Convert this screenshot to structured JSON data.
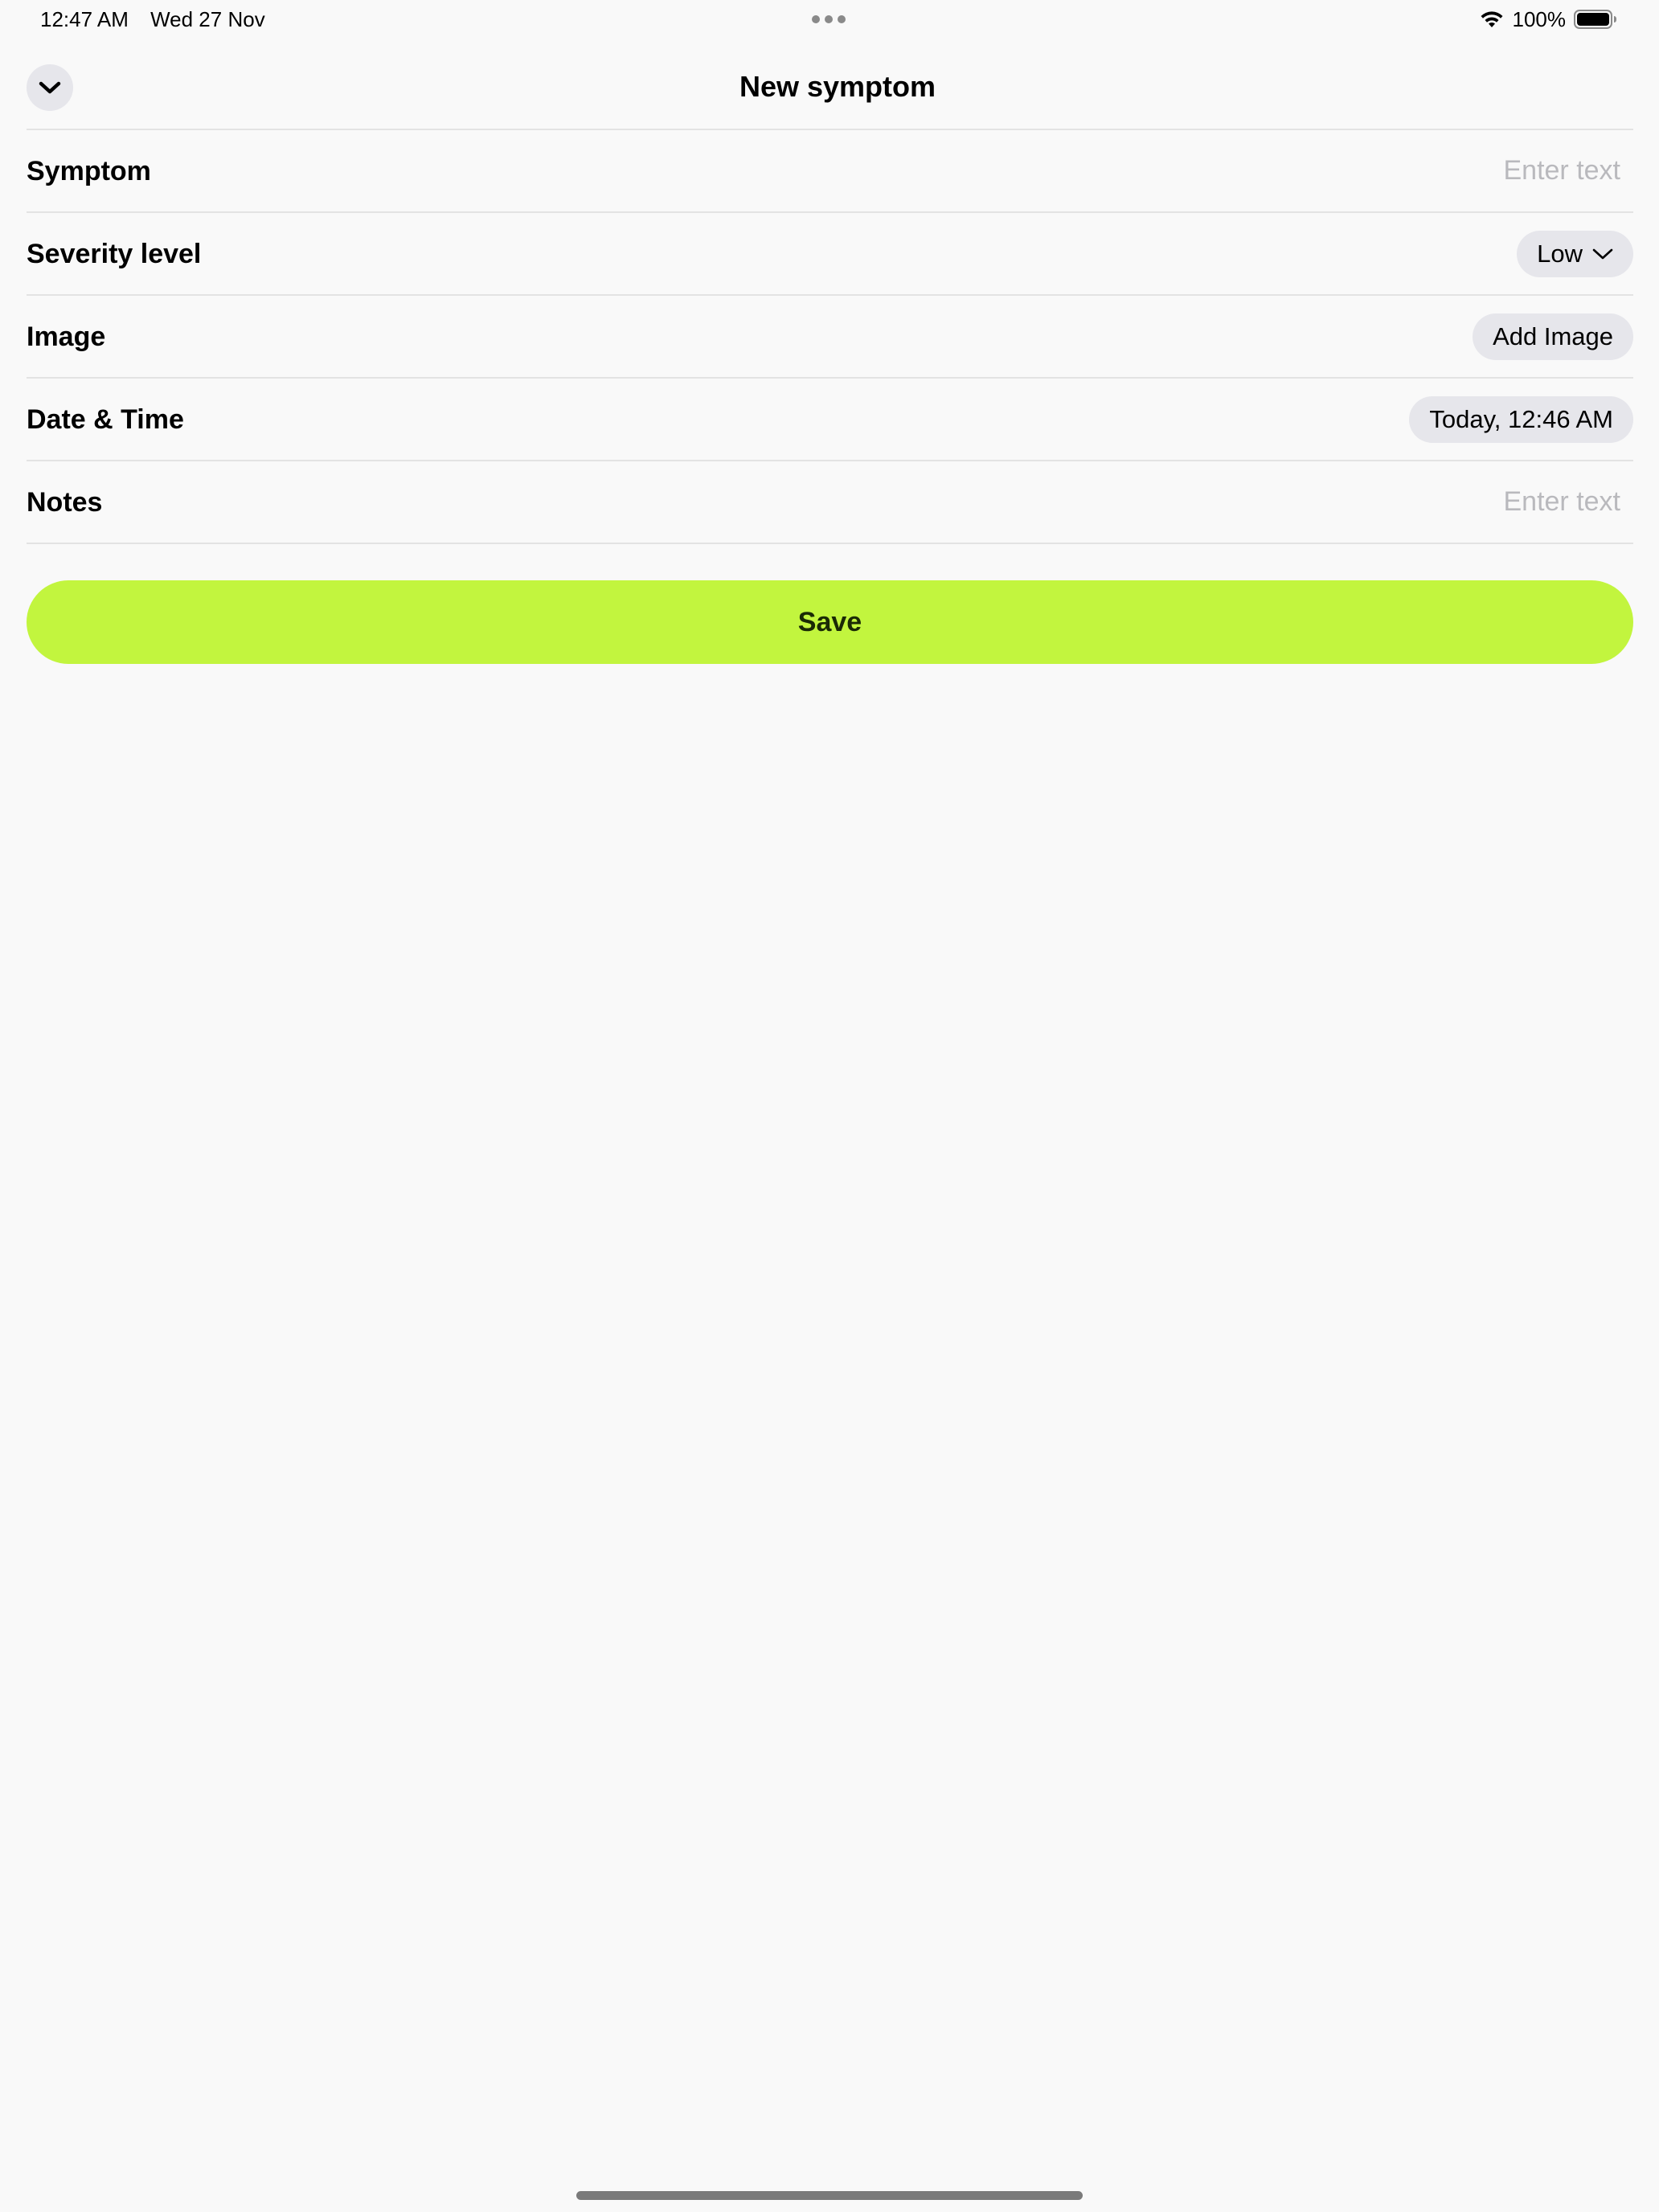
{
  "status_bar": {
    "time": "12:47 AM",
    "date": "Wed 27 Nov",
    "battery": "100%"
  },
  "header": {
    "title": "New symptom"
  },
  "form": {
    "symptom": {
      "label": "Symptom",
      "placeholder": "Enter text",
      "value": ""
    },
    "severity": {
      "label": "Severity level",
      "value": "Low"
    },
    "image": {
      "label": "Image",
      "button_label": "Add Image"
    },
    "datetime": {
      "label": "Date & Time",
      "value": "Today, 12:46 AM"
    },
    "notes": {
      "label": "Notes",
      "placeholder": "Enter text",
      "value": ""
    }
  },
  "save": {
    "label": "Save"
  },
  "colors": {
    "background": "#f9f9f9",
    "accent": "#c2f53e",
    "pill": "#e6e6eb",
    "divider": "#e3e3e3",
    "placeholder": "#b9b9bd"
  }
}
